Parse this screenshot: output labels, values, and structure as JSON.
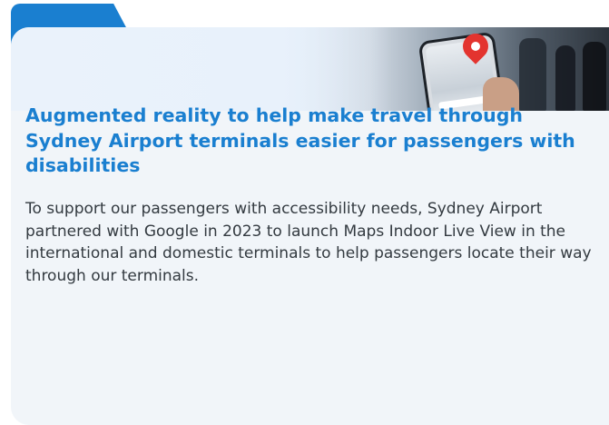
{
  "card": {
    "accent_color": "#1a7fd0",
    "background_color": "#f1f5f9",
    "image": {
      "icon": "location-pin-icon",
      "pin_color": "#e3342f"
    },
    "headline": "Augmented reality to help make travel through Sydney Airport terminals easier for passengers with disabilities",
    "body": "To support our passengers with accessibility needs, Sydney Airport partnered with Google in 2023 to launch Maps Indoor Live View in the international and domestic terminals to help passengers locate their way through our terminals."
  }
}
